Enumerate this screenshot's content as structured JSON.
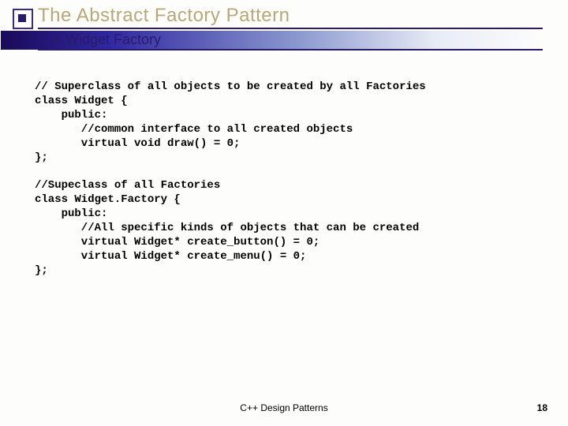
{
  "header": {
    "title": "The Abstract Factory Pattern",
    "subtitle": ": : A Widget Factory"
  },
  "code": {
    "block1_l1": "// Superclass of all objects to be created by all Factories",
    "block1_l2": "class Widget {",
    "block1_l3": "    public:",
    "block1_l4": "       //common interface to all created objects",
    "block1_l5": "       virtual void draw() = 0;",
    "block1_l6": "};",
    "block2_l1": "//Supeclass of all Factories",
    "block2_l2": "class Widget.Factory {",
    "block2_l3": "    public:",
    "block2_l4": "       //All specific kinds of objects that can be created",
    "block2_l5": "       virtual Widget* create_button() = 0;",
    "block2_l6": "       virtual Widget* create_menu() = 0;",
    "block2_l7": "};"
  },
  "footer": {
    "center": "C++ Design Patterns",
    "page": "18"
  }
}
